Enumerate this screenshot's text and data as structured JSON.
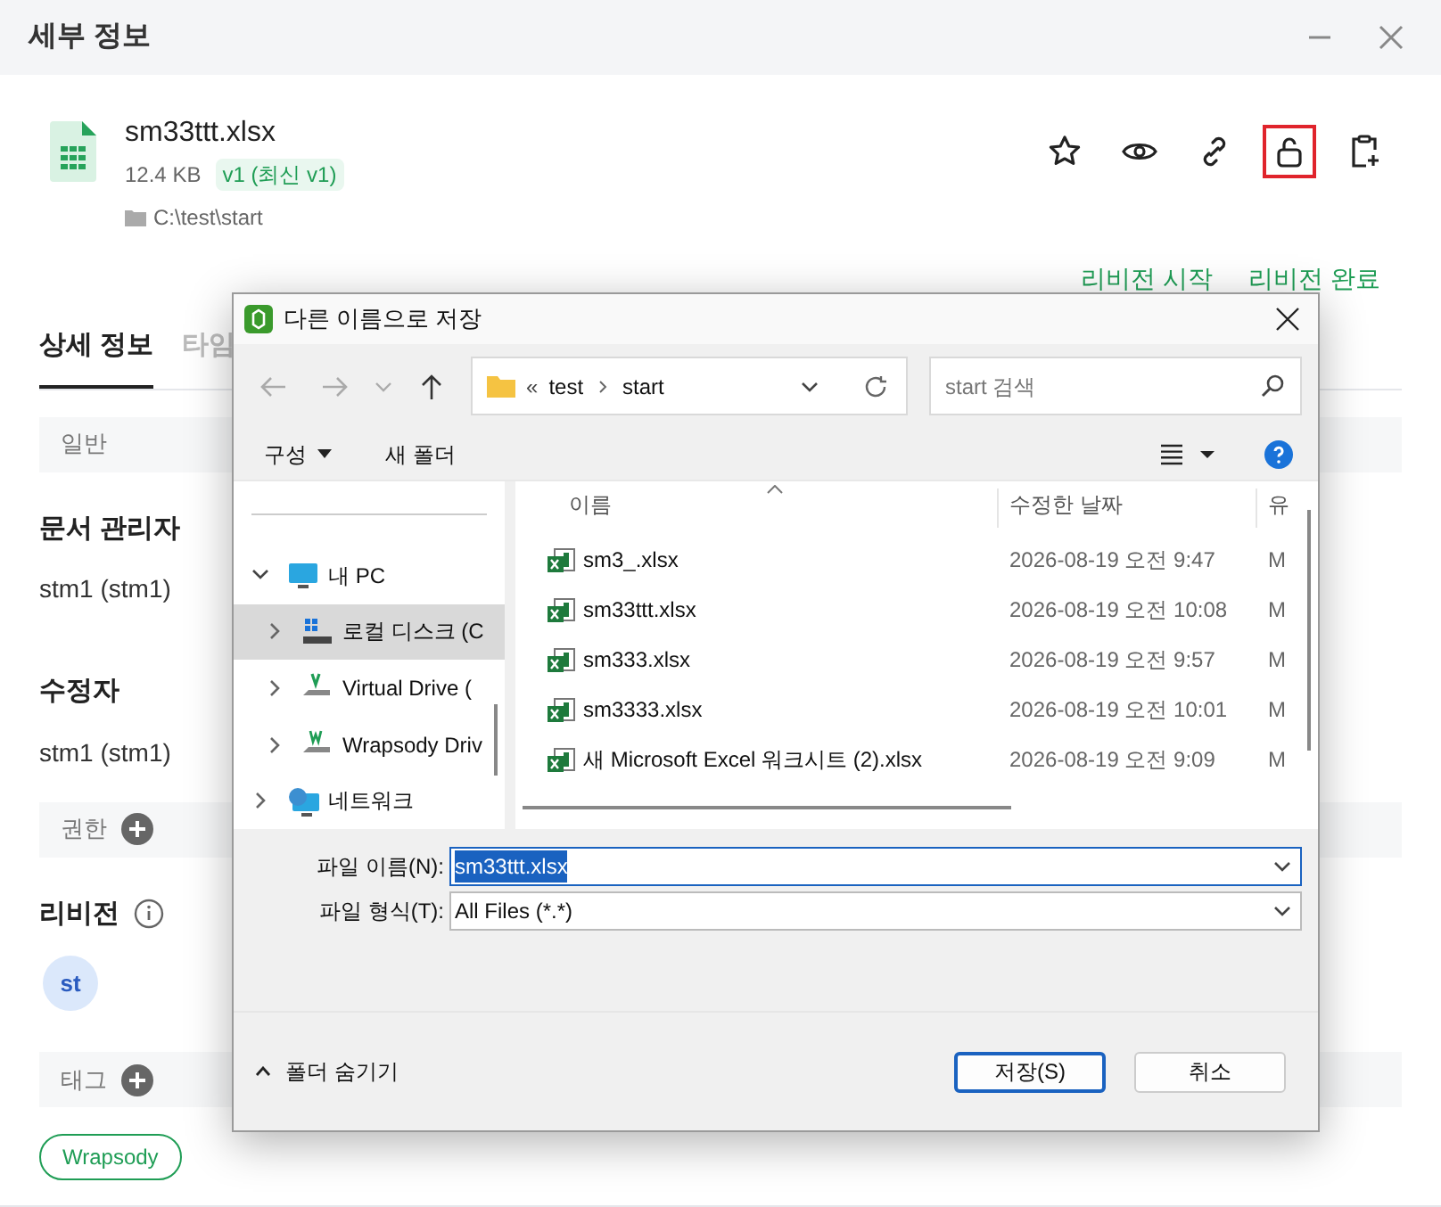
{
  "panel": {
    "title": "세부 정보",
    "file": {
      "name": "sm33ttt.xlsx",
      "size": "12.4 KB",
      "version": "v1 (최신 v1)",
      "path": "C:\\test\\start"
    },
    "actions": [
      {
        "kind": "star",
        "highlighted": false
      },
      {
        "kind": "eye",
        "highlighted": false
      },
      {
        "kind": "link",
        "highlighted": false
      },
      {
        "kind": "unlock",
        "highlighted": true
      },
      {
        "kind": "clipboard",
        "highlighted": false
      }
    ],
    "links": [
      "리비전 시작",
      "리비전 완료"
    ],
    "tabs": [
      {
        "label": "상세 정보",
        "selected": true
      },
      {
        "label": "타임",
        "selected": false
      }
    ],
    "sections": [
      {
        "kind": "bar",
        "label": "일반",
        "add": false
      },
      {
        "kind": "heading",
        "label": "문서 관리자",
        "info": false
      },
      {
        "kind": "text",
        "label": "stm1 (stm1)"
      },
      {
        "kind": "heading",
        "label": "수정자",
        "info": false
      },
      {
        "kind": "text",
        "label": "stm1 (stm1)"
      },
      {
        "kind": "bar",
        "label": "권한",
        "add": true
      },
      {
        "kind": "heading",
        "label": "리비전",
        "info": true
      },
      {
        "kind": "avatar",
        "label": "st"
      },
      {
        "kind": "bar",
        "label": "태그",
        "add": true
      },
      {
        "kind": "tags",
        "tags": [
          "Wrapsody"
        ]
      }
    ]
  },
  "dialog": {
    "title": "다른 이름으로 저장",
    "address": {
      "prefix": "«",
      "parts": [
        "test",
        "start"
      ]
    },
    "search": {
      "placeholder": "start 검색"
    },
    "toolbar": [
      "구성",
      "새 폴더"
    ],
    "tree": [
      {
        "label": "내 PC",
        "kind": "pc",
        "expanded": true,
        "selected": false,
        "children": [
          {
            "label": "로컬 디스크 (C",
            "kind": "disk",
            "expanded": false,
            "selected": true
          },
          {
            "label": "Virtual Drive (",
            "kind": "vdrive",
            "expanded": false,
            "selected": false
          },
          {
            "label": "Wrapsody Driv",
            "kind": "wdrive",
            "expanded": false,
            "selected": false
          }
        ]
      },
      {
        "label": "네트워크",
        "kind": "network",
        "expanded": false,
        "selected": false
      }
    ],
    "columns": [
      "이름",
      "수정한 날짜",
      "유"
    ],
    "files": [
      {
        "name": "sm3_.xlsx",
        "modified": "2026-08-19 오전 9:47",
        "column_3": "M"
      },
      {
        "name": "sm33ttt.xlsx",
        "modified": "2026-08-19 오전 10:08",
        "column_3": "M"
      },
      {
        "name": "sm333.xlsx",
        "modified": "2026-08-19 오전 9:57",
        "column_3": "M"
      },
      {
        "name": "sm3333.xlsx",
        "modified": "2026-08-19 오전 10:01",
        "column_3": "M"
      },
      {
        "name": "새 Microsoft Excel 워크시트 (2).xlsx",
        "modified": "2026-08-19 오전 9:09",
        "column_3": "M"
      }
    ],
    "fields": [
      {
        "label": "파일 이름(N):",
        "value": "sm33ttt.xlsx",
        "highlighted": true
      },
      {
        "label": "파일 형식(T):",
        "value": "All Files (*.*)",
        "highlighted": false
      }
    ],
    "hide_folders": "폴더 숨기기",
    "buttons": [
      {
        "label": "저장(S)",
        "default": true
      },
      {
        "label": "취소",
        "default": false
      }
    ]
  }
}
